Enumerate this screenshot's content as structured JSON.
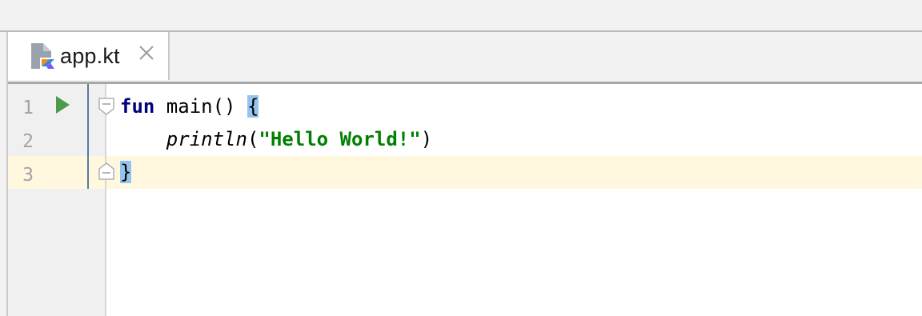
{
  "tab": {
    "filename": "app.kt"
  },
  "gutter": {
    "line_numbers": [
      "1",
      "2",
      "3"
    ]
  },
  "code": {
    "line1": {
      "keyword": "fun",
      "rest": " main() ",
      "brace": "{"
    },
    "line2": {
      "indent": "    ",
      "call": "println",
      "open": "(",
      "string": "\"Hello World!\"",
      "close": ")"
    },
    "line3": {
      "brace": "}"
    }
  },
  "colors": {
    "keyword": "#000080",
    "string": "#008000",
    "brace_highlight": "#93c3ee",
    "current_line": "#fff8de",
    "run_icon": "#4a9c4a"
  }
}
